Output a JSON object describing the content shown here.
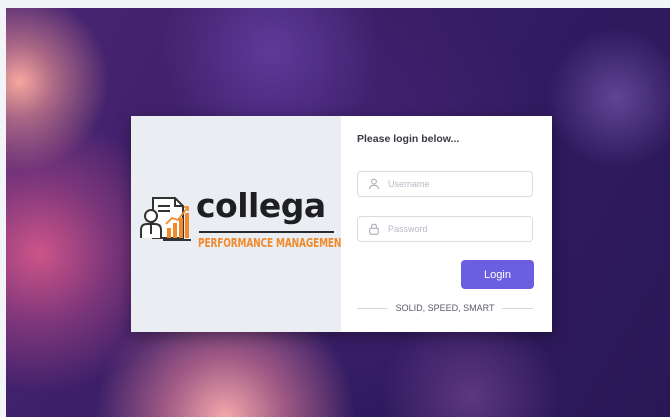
{
  "brand": {
    "name": "collega",
    "tagline": "PERFORMANCE MANAGEMENT",
    "colors": {
      "accent": "#f08a2c",
      "wordmark": "#1f1f22"
    }
  },
  "login": {
    "heading": "Please login below...",
    "username": {
      "placeholder": "Username",
      "value": "",
      "icon": "user-icon"
    },
    "password": {
      "placeholder": "Password",
      "value": "",
      "icon": "lock-icon"
    },
    "submit_label": "Login",
    "motto": "SOLID, SPEED, SMART",
    "colors": {
      "button": "#6a5fe0",
      "button_text": "#ffffff"
    }
  }
}
